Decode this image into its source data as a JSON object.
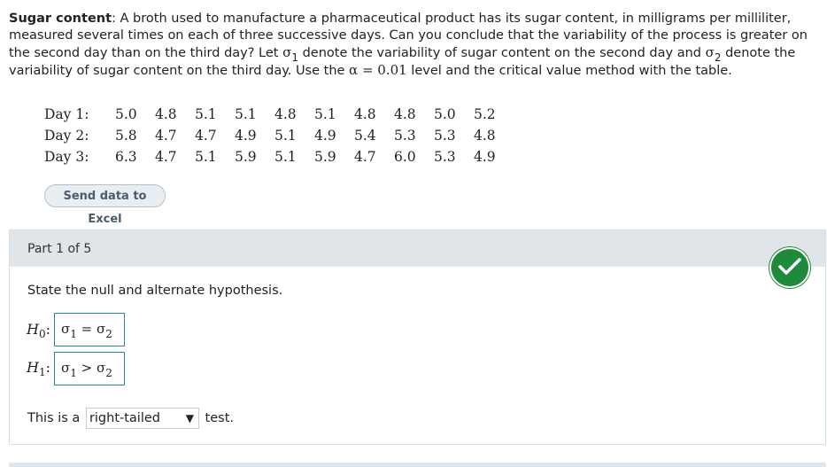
{
  "problem": {
    "title": "Sugar content",
    "text1": ": A broth used to manufacture a pharmaceutical product has its sugar content, in milligrams per milliliter, measured several times on each of three successive days. Can you conclude that the variability of the process is greater on the second day than on the third day? Let ",
    "sigma": "σ",
    "sub1": "1",
    "text2": " denote the variability of sugar content on the second day and ",
    "sub2": "2",
    "text3": " denote the variability of sugar content on the third day. Use the ",
    "alpha_expr": "α = 0.01",
    "text4": " level and the critical value method with the table."
  },
  "data_table": {
    "rows": [
      {
        "label": "Day 1:",
        "values": [
          "5.0",
          "4.8",
          "5.1",
          "5.1",
          "4.8",
          "5.1",
          "4.8",
          "4.8",
          "5.0",
          "5.2"
        ]
      },
      {
        "label": "Day 2:",
        "values": [
          "5.8",
          "4.7",
          "4.7",
          "4.9",
          "5.1",
          "4.9",
          "5.4",
          "5.3",
          "5.3",
          "4.8"
        ]
      },
      {
        "label": "Day 3:",
        "values": [
          "6.3",
          "4.7",
          "5.1",
          "5.9",
          "5.1",
          "5.9",
          "4.7",
          "6.0",
          "5.3",
          "4.9"
        ]
      }
    ]
  },
  "excel_button": {
    "label": "Send data to Excel"
  },
  "part": {
    "header": "Part 1 of 5",
    "instruction": "State the null and alternate hypothesis.",
    "status": "correct",
    "h0": {
      "label": "H",
      "sub": "0",
      "colon": ":",
      "lhs": "σ",
      "lhs_sub": "1",
      "op": "=",
      "rhs": "σ",
      "rhs_sub": "2"
    },
    "h1": {
      "label": "H",
      "sub": "1",
      "colon": ":",
      "lhs": "σ",
      "lhs_sub": "1",
      "op": ">",
      "rhs": "σ",
      "rhs_sub": "2"
    },
    "test_prefix": "This is a",
    "test_selected": "right-tailed",
    "test_suffix": "test."
  },
  "colors": {
    "check_green": "#1f8a3b",
    "header_bg": "#dfe5e9",
    "answer_border": "#2a8a9e"
  },
  "icons": {
    "check": "check-icon",
    "dropdown": "triangle-down-icon"
  }
}
